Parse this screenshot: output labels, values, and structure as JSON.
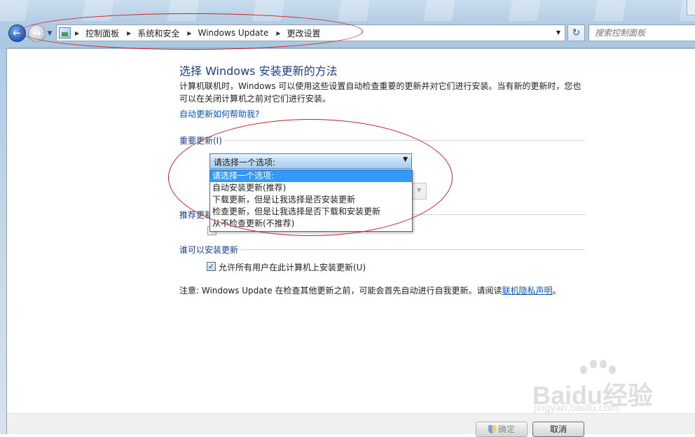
{
  "address_bar": {
    "breadcrumbs": [
      "控制面板",
      "系统和安全",
      "Windows Update",
      "更改设置"
    ]
  },
  "search": {
    "placeholder": "搜索控制面板"
  },
  "main": {
    "title": "选择 Windows 安装更新的方法",
    "intro": "计算机联机时，Windows 可以使用这些设置自动检查重要的更新并对它们进行安装。当有新的更新时，您也可以在关闭计算机之前对它们进行安装。",
    "help_link": "自动更新如何帮助我?",
    "important_updates": {
      "label": "重要更新(I)",
      "selected": "请选择一个选项:",
      "options": [
        "请选择一个选项:",
        "自动安装更新(推荐)",
        "下载更新，但是让我选择是否安装更新",
        "检查更新，但是让我选择是否下载和安装更新",
        "从不检查更新(不推荐)"
      ]
    },
    "recommended_updates": {
      "label": "推荐更新"
    },
    "who_can_install": {
      "label": "谁可以安装更新",
      "checkbox_label": "允许所有用户在此计算机上安装更新(U)",
      "checked": true
    },
    "note": {
      "text": "注意: Windows Update 在检查其他更新之前，可能会首先自动进行自我更新。请阅读",
      "link": "联机隐私声明",
      "suffix": "。"
    }
  },
  "buttons": {
    "ok": "确定",
    "cancel": "取消"
  },
  "watermark": {
    "brand": "Baidu经验",
    "url": "jingyan.baidu.com"
  },
  "colors": {
    "title_blue": "#1a3f8f",
    "link_blue": "#0a55b5",
    "selection": "#3399ff",
    "annotation_red": "#cf1d24"
  }
}
